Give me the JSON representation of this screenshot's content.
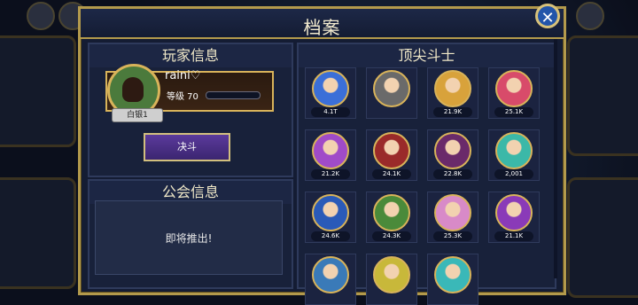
{
  "window": {
    "title": "档案",
    "close_icon": "close-icon"
  },
  "player_panel": {
    "heading": "玩家信息",
    "player_name": "raini♡",
    "level_label": "等级 70",
    "rank": "白银1",
    "level_progress": 0.0,
    "duel_button": "决斗"
  },
  "guild_panel": {
    "heading": "公会信息",
    "message": "即将推出!"
  },
  "top_fighters": {
    "heading": "顶尖斗士",
    "fighters": [
      {
        "label": "4.1T",
        "color": "#3b6fd8"
      },
      {
        "label": "",
        "color": "#6a6a6a"
      },
      {
        "label": "21.9K",
        "color": "#d8a23b"
      },
      {
        "label": "25.1K",
        "color": "#d84b6a"
      },
      {
        "label": "21.2K",
        "color": "#a04bc8"
      },
      {
        "label": "24.1K",
        "color": "#9a2a2a"
      },
      {
        "label": "22.8K",
        "color": "#6a2a6a"
      },
      {
        "label": "2,001",
        "color": "#3bb8a8"
      },
      {
        "label": "24.6K",
        "color": "#2a5ab8"
      },
      {
        "label": "24.3K",
        "color": "#4a8a3a"
      },
      {
        "label": "25.3K",
        "color": "#d88ac8"
      },
      {
        "label": "21.1K",
        "color": "#8a3ab8"
      },
      {
        "label": "",
        "color": "#3a7ab8"
      },
      {
        "label": "",
        "color": "#c8b83a"
      },
      {
        "label": "",
        "color": "#3ab8b8"
      }
    ]
  }
}
